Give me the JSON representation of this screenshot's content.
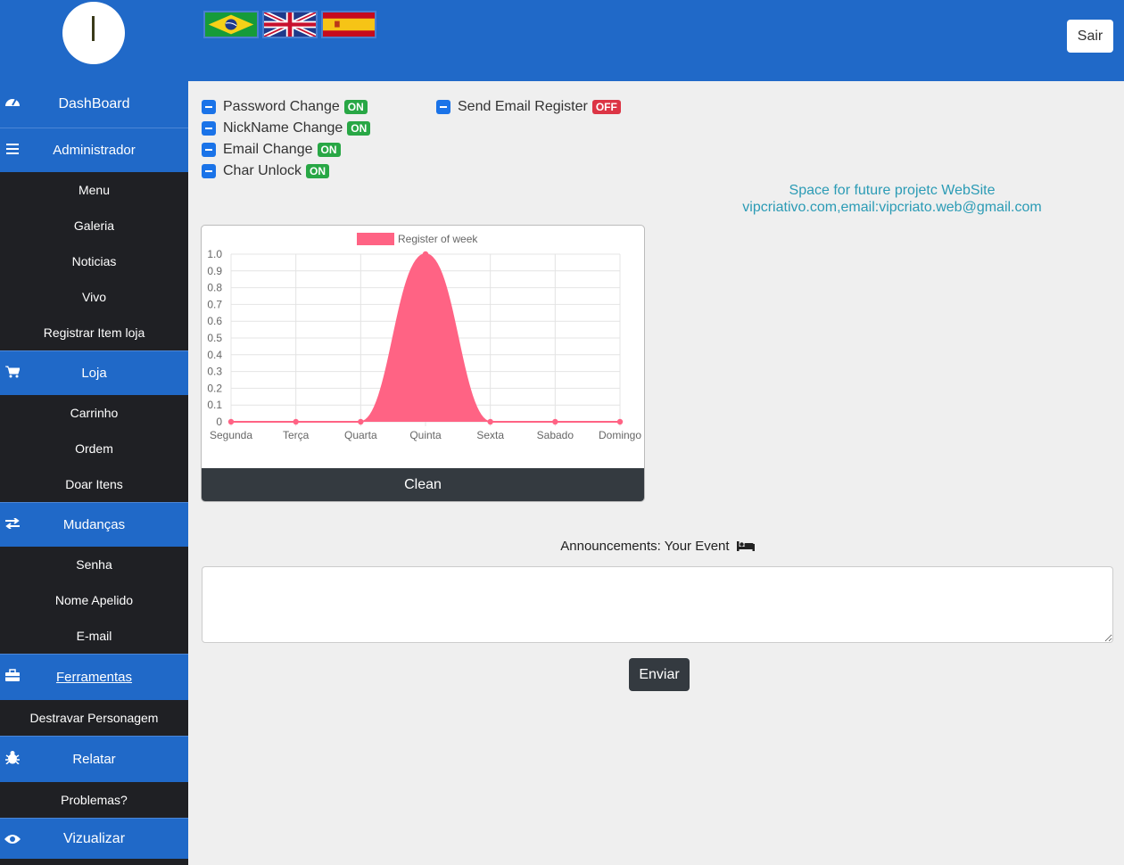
{
  "header": {
    "logo_letter": "I",
    "flags": [
      {
        "name": "brazil",
        "label": "Português"
      },
      {
        "name": "uk",
        "label": "English"
      },
      {
        "name": "spain",
        "label": "Español"
      }
    ],
    "logout_label": "Sair"
  },
  "sidebar": {
    "dashboard": "DashBoard",
    "admin": {
      "label": "Administrador",
      "items": [
        "Menu",
        "Galeria",
        "Noticias",
        "Vivo",
        "Registrar Item loja"
      ]
    },
    "loja": {
      "label": "Loja",
      "items": [
        "Carrinho",
        "Ordem",
        "Doar Itens"
      ]
    },
    "mudancas": {
      "label": "Mudanças",
      "items": [
        "Senha",
        "Nome Apelido",
        "E-mail"
      ]
    },
    "ferramentas": {
      "label": "Ferramentas",
      "items": [
        "Destravar Personagem"
      ]
    },
    "relatar": {
      "label": "Relatar",
      "items": [
        "Problemas?"
      ]
    },
    "vizualizar": "Vizualizar"
  },
  "settings": {
    "left": [
      {
        "label": "Password Change",
        "status": "ON"
      },
      {
        "label": "NickName Change",
        "status": "ON"
      },
      {
        "label": "Email Change",
        "status": "ON"
      },
      {
        "label": "Char Unlock",
        "status": "ON"
      }
    ],
    "right": [
      {
        "label": "Send Email Register",
        "status": "OFF"
      }
    ]
  },
  "promo": {
    "line1": "Space for future projetc WebSite",
    "line2": "vipcriativo.com,email:vipcriato.web@gmail.com"
  },
  "chart_data": {
    "type": "area",
    "categories": [
      "Segunda",
      "Terça",
      "Quarta",
      "Quinta",
      "Sexta",
      "Sabado",
      "Domingo"
    ],
    "series": [
      {
        "name": "Register of week",
        "values": [
          0,
          0,
          0,
          1,
          0,
          0,
          0
        ],
        "color": "#ff6384"
      }
    ],
    "ylim": [
      0,
      1.0
    ],
    "yticks": [
      "0",
      "0.1",
      "0.2",
      "0.3",
      "0.4",
      "0.5",
      "0.6",
      "0.7",
      "0.8",
      "0.9",
      "1.0"
    ],
    "grid": true,
    "legend": "top"
  },
  "chart_button": "Clean",
  "announcements": {
    "label": "Announcements: Your Event",
    "placeholder": "",
    "submit_label": "Enviar"
  },
  "colors": {
    "primary": "#2069c8",
    "sidebar_dark": "#1f2024",
    "on": "#28a745",
    "off": "#dc3545",
    "chart": "#ff6384"
  }
}
